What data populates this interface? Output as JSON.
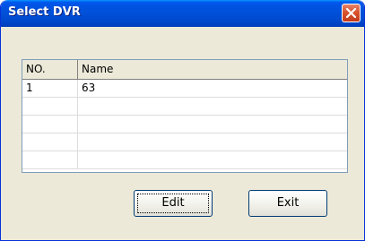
{
  "window": {
    "title": "Select DVR"
  },
  "grid": {
    "columns": [
      "NO.",
      "Name"
    ],
    "rows": [
      {
        "no": "1",
        "name": "63"
      },
      {
        "no": "",
        "name": ""
      },
      {
        "no": "",
        "name": ""
      },
      {
        "no": "",
        "name": ""
      },
      {
        "no": "",
        "name": ""
      }
    ]
  },
  "buttons": {
    "edit": "Edit",
    "exit": "Exit"
  },
  "colors": {
    "titlebar": "#0053e1",
    "close_button": "#d9542f",
    "dialog_background": "#ece9d8"
  },
  "icons": {
    "close": "close-icon"
  }
}
